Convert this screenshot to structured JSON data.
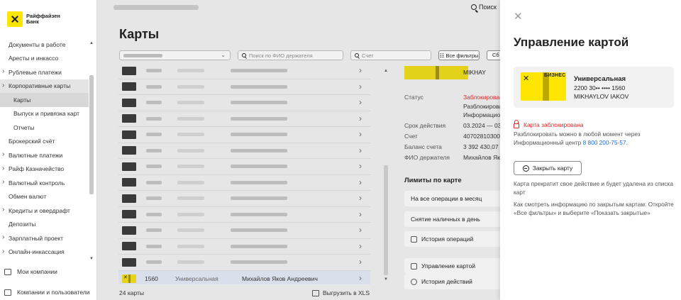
{
  "brand": {
    "line1": "Райффайзен",
    "line2": "Банк"
  },
  "sidebar": {
    "items": [
      {
        "label": "Документы в работе",
        "arrow": false,
        "sub": false
      },
      {
        "label": "Аресты и инкассо",
        "arrow": false,
        "sub": false
      },
      {
        "label": "Рублевые платежи",
        "arrow": true,
        "sub": false
      },
      {
        "label": "Корпоративные карты",
        "arrow": true,
        "sub": false,
        "active": true
      },
      {
        "label": "Карты",
        "arrow": false,
        "sub": true,
        "selected": true
      },
      {
        "label": "Выпуск и привязка карт",
        "arrow": false,
        "sub": true
      },
      {
        "label": "Отчеты",
        "arrow": false,
        "sub": true
      },
      {
        "label": "Брокерский счёт",
        "arrow": false,
        "sub": false
      },
      {
        "label": "Валютные платежи",
        "arrow": true,
        "sub": false
      },
      {
        "label": "Райф Казначейство",
        "arrow": true,
        "sub": false
      },
      {
        "label": "Валютный контроль",
        "arrow": true,
        "sub": false
      },
      {
        "label": "Обмен валют",
        "arrow": false,
        "sub": false
      },
      {
        "label": "Кредиты и овердрафт",
        "arrow": true,
        "sub": false
      },
      {
        "label": "Депозиты",
        "arrow": false,
        "sub": false
      },
      {
        "label": "Зарплатный проект",
        "arrow": true,
        "sub": false
      },
      {
        "label": "Онлайн-инкассация",
        "arrow": true,
        "sub": false
      }
    ],
    "my_companies": "Мои компании",
    "companies_users": "Компании и пользователи"
  },
  "header": {
    "search_label": "Поиск"
  },
  "page": {
    "title": "Карты"
  },
  "filters": {
    "holder_placeholder": "Поиск по ФИО держателя",
    "account_placeholder": "Счет",
    "all_filters": "Все фильтры",
    "reset_short": "Сб"
  },
  "list": {
    "selected_row": {
      "number": "1560",
      "type": "Универсальная",
      "holder": "Михайлов Яков Андреевич"
    },
    "count_label": "24 карты",
    "export_label": "Выгрузить в XLS"
  },
  "detail": {
    "holder_latin_partial": "MIKHAY",
    "fields": [
      {
        "label": "Статус",
        "value": "Заблокирована",
        "red": true
      },
      {
        "label": "",
        "value": "Разблокировать"
      },
      {
        "label": "",
        "value": "Информацион"
      },
      {
        "label": "Срок действия",
        "value": "03.2024 — 03"
      },
      {
        "label": "Счет",
        "value": "40702810300"
      },
      {
        "label": "Баланс счета",
        "value": "3 392 430,07"
      },
      {
        "label": "ФИО держателя",
        "value": "Михайлов Яко"
      }
    ],
    "limits_title": "Лимиты по карте",
    "limit_buttons": [
      "На все операции в месяц",
      "Снятие наличных в день"
    ],
    "history_ops": "История операций",
    "manage_card": "Управление картой",
    "history_actions": "История действий"
  },
  "modal": {
    "title": "Управление картой",
    "card": {
      "badge": "БИЗНЕС",
      "type": "Универсальная",
      "number": "2200 30•• •••• 1560",
      "holder": "MIKHAYLOV IAKOV"
    },
    "status_text": "Карта заблокирована",
    "unlock_text": "Разблокировать можно в любой момент через Информационный центр",
    "phone": "8 800 200-75-57",
    "close_card_button": "Закрыть карту",
    "close_note": "Карта прекратит свое действие и будет удалена из списка карт",
    "closed_info": "Как смотреть информацию по закрытым картам: Откройте «Все фильтры» и выберите «Показать закрытые»"
  },
  "colors": {
    "brand_yellow": "#fee600",
    "alert_red": "#d62b2b",
    "link_blue": "#1f6bc4",
    "selected_row": "#d9e0ec"
  }
}
